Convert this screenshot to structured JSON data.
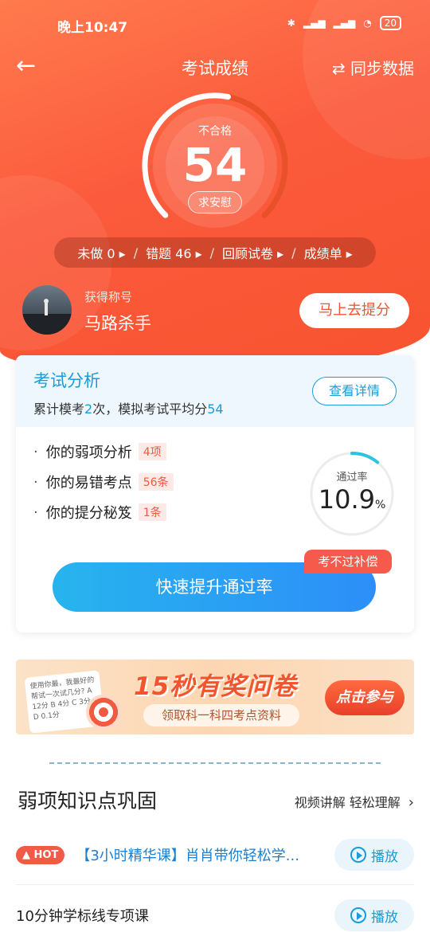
{
  "status_bar": {
    "time": "晚上10:47",
    "battery": "20"
  },
  "nav": {
    "back": "←",
    "title": "考试成绩",
    "sync": "⇄ 同步数据"
  },
  "result": {
    "status": "不合格",
    "score": "54",
    "comfort": "求安慰",
    "score_max": 100
  },
  "quick_links": [
    {
      "label": "未做 0 ▸"
    },
    {
      "label": "错题  46 ▸"
    },
    {
      "label": "回顾试卷 ▸"
    },
    {
      "label": "成绩单 ▸"
    }
  ],
  "profile": {
    "label": "获得称号",
    "name": "马路杀手",
    "button": "马上去提分"
  },
  "analysis": {
    "title": "考试分析",
    "sub_prefix": "累计模考",
    "count": "2",
    "sub_middle": "次，模拟考试平均分",
    "avg": "54",
    "detail_button": "查看详情",
    "items": [
      {
        "label": "你的弱项分析",
        "tag": "4项"
      },
      {
        "label": "你的易错考点",
        "tag": "56条"
      },
      {
        "label": "你的提分秘笈",
        "tag": "1条"
      }
    ],
    "pass_rate_label": "通过率",
    "pass_rate_value": "10.9",
    "pass_rate_unit": "%",
    "pass_rate": 10.9,
    "promo_tag": "考不过补偿",
    "cta": "快速提升通过率"
  },
  "banner": {
    "card_text": "使用你最，我最好的 帮试一次试几分? A 12分 B 4分 C 3分 D 0.1分",
    "title": "15秒有奖问卷",
    "subtitle": "领取科一科四考点资料",
    "button": "点击参与"
  },
  "weak": {
    "title": "弱项知识点巩固",
    "link": "视频讲解 轻松理解",
    "chevron": "›",
    "courses": [
      {
        "badge": "HOT",
        "title": "【3小时精华课】肖肖带你轻松学...",
        "play": "播放"
      },
      {
        "badge": "",
        "title": "10分钟学标线专项课",
        "play": "播放"
      }
    ]
  },
  "colors": {
    "primary_orange": "#f7532f",
    "accent_blue": "#1c9bd8",
    "tag_red": "#f05a40"
  }
}
